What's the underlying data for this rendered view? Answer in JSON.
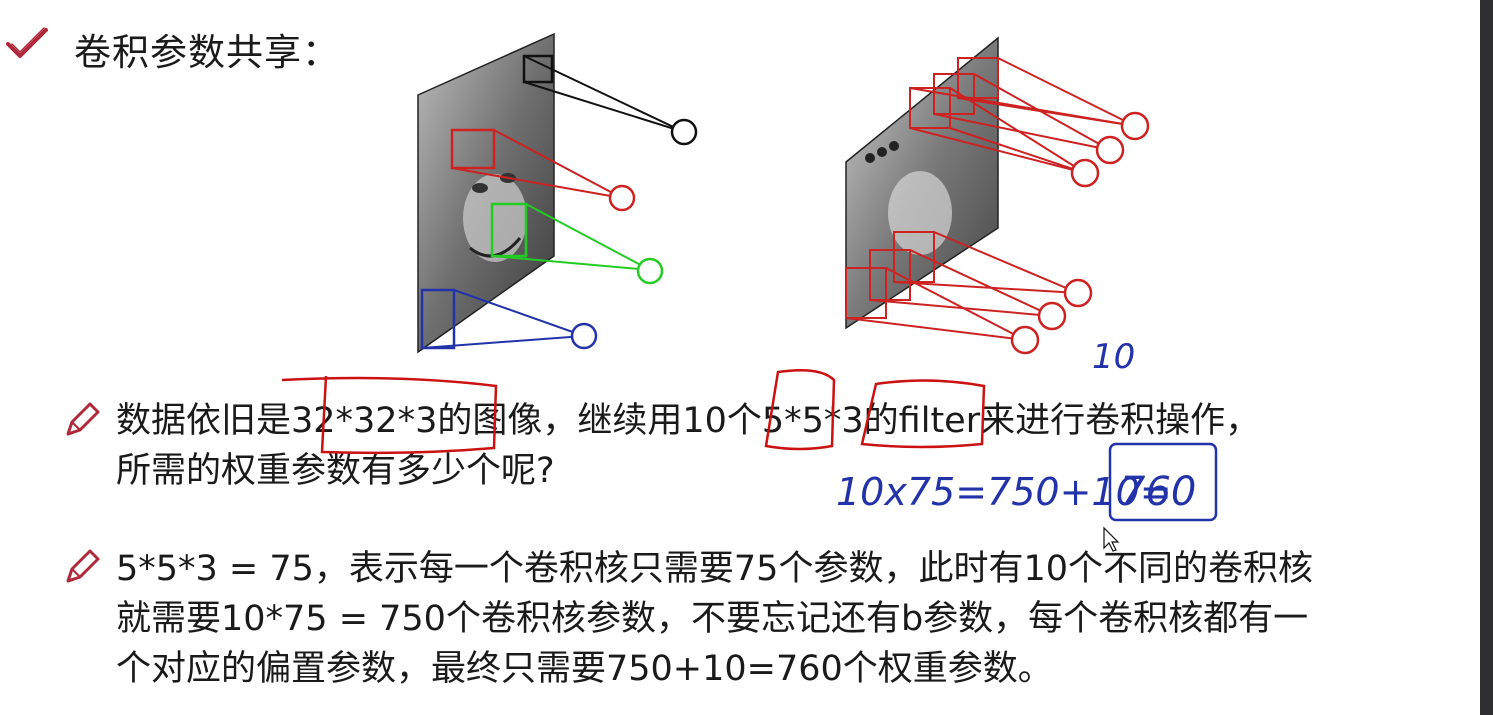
{
  "slide": {
    "title": "卷积参数共享：",
    "question": {
      "line1": "数据依旧是32*32*3的图像，继续用10个5*5*3的filter来进行卷积操作，",
      "line2": "所需的权重参数有多少个呢?"
    },
    "answer": {
      "line1": "5*5*3 = 75，表示每一个卷积核只需要75个参数，此时有10个不同的卷积核",
      "line2": "就需要10*75 = 750个卷积核参数，不要忘记还有b参数，每个卷积核都有一",
      "line3": "个对应的偏置参数，最终只需要750+10=760个权重参数。"
    }
  },
  "handwriting": {
    "ten": "10",
    "calc": "10x75=750+10=",
    "result": "760"
  },
  "colors": {
    "check": "#b0283a",
    "pencil": "#b0283a",
    "red_marker": "#cc1111",
    "blue_marker": "#2233aa"
  }
}
